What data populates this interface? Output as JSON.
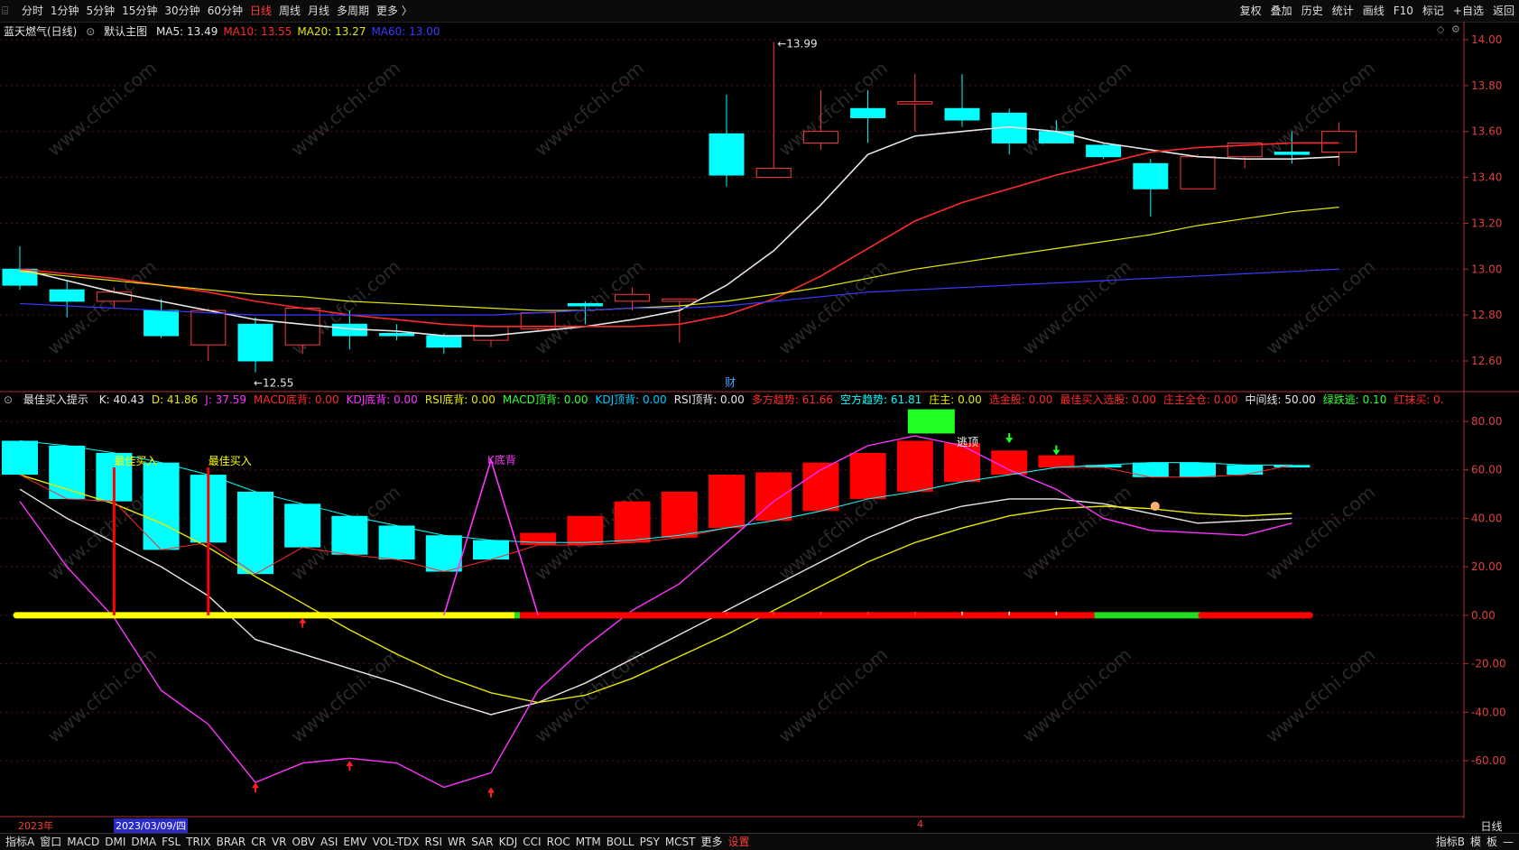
{
  "toolbar": {
    "timeframes": [
      "分时",
      "1分钟",
      "5分钟",
      "15分钟",
      "30分钟",
      "60分钟",
      "日线",
      "周线",
      "月线",
      "多周期",
      "更多 〉"
    ],
    "active_timeframe": "日线",
    "right_buttons": [
      "复权",
      "叠加",
      "历史",
      "统计",
      "画线",
      "F10",
      "标记",
      "+自选",
      "返回"
    ]
  },
  "main_panel": {
    "title": "蓝天燃气(日线)",
    "template": "默认主图",
    "ma": [
      {
        "label": "MA5: 13.49",
        "color": "#e6e6e6"
      },
      {
        "label": "MA10: 13.55",
        "color": "#ff2a2a"
      },
      {
        "label": "MA20: 13.27",
        "color": "#e6e600"
      },
      {
        "label": "MA60: 13.00",
        "color": "#3a3aff"
      }
    ],
    "price_ticks": [
      "14.00",
      "13.80",
      "13.60",
      "13.40",
      "13.20",
      "13.00",
      "12.80",
      "12.60"
    ],
    "high_label": "13.99",
    "low_label": "12.55",
    "fin_marker": "财"
  },
  "indicator_panel": {
    "name": "最佳买入提示",
    "values": [
      {
        "label": "K: 40.43",
        "color": "#e6e6e6"
      },
      {
        "label": "D: 41.86",
        "color": "#e6e600"
      },
      {
        "label": "J: 37.59",
        "color": "#ff33ff"
      },
      {
        "label": "MACD底背: 0.00",
        "color": "#ff2a2a"
      },
      {
        "label": "KDJ底背: 0.00",
        "color": "#ff33ff"
      },
      {
        "label": "RSI底背: 0.00",
        "color": "#e6e600"
      },
      {
        "label": "MACD顶背: 0.00",
        "color": "#33ff33"
      },
      {
        "label": "KDJ顶背: 0.00",
        "color": "#00ccff"
      },
      {
        "label": "RSI顶背: 0.00",
        "color": "#e6e6e6"
      },
      {
        "label": "多方趋势: 61.66",
        "color": "#ff2a2a"
      },
      {
        "label": "空方趋势: 61.81",
        "color": "#00ffff"
      },
      {
        "label": "庄主: 0.00",
        "color": "#e6e600"
      },
      {
        "label": "选金股: 0.00",
        "color": "#ff2a2a"
      },
      {
        "label": "最佳买入选股: 0.00",
        "color": "#ff2a2a"
      },
      {
        "label": "庄主全仓: 0.00",
        "color": "#ff2a2a"
      },
      {
        "label": "中间线: 50.00",
        "color": "#e6e6e6"
      },
      {
        "label": "绿跌逃: 0.10",
        "color": "#33ff33"
      },
      {
        "label": "红抹买: 0.",
        "color": "#ff2a2a"
      }
    ],
    "ticks": [
      "80.00",
      "60.00",
      "40.00",
      "20.00",
      "0.00",
      "-20.00",
      "-40.00",
      "-60.00"
    ],
    "buy_labels": [
      "最佳买入",
      "最佳买入"
    ],
    "kdj_label": "K底背",
    "escape_label": "逃顶"
  },
  "date_axis": {
    "year": "2023年",
    "cursor_date": "2023/03/09/四",
    "month": "4",
    "cycle": "日线"
  },
  "bottom_tabs": [
    "指标A",
    "窗口",
    "MACD",
    "DMI",
    "DMA",
    "FSL",
    "TRIX",
    "BRAR",
    "CR",
    "VR",
    "OBV",
    "ASI",
    "EMV",
    "VOL-TDX",
    "RSI",
    "WR",
    "SAR",
    "KDJ",
    "CCI",
    "ROC",
    "MTM",
    "BOLL",
    "PSY",
    "MCST",
    "更多",
    "设置"
  ],
  "bottom_right": [
    "指标B",
    "模",
    "板",
    "—"
  ],
  "watermark": "www.cfchi.com",
  "chart_data": [
    {
      "type": "candlestick",
      "title": "蓝天燃气(日线)",
      "ylim": [
        12.5,
        14.05
      ],
      "candles": [
        {
          "o": 13.0,
          "h": 13.1,
          "l": 12.91,
          "c": 12.93
        },
        {
          "o": 12.91,
          "h": 12.95,
          "l": 12.79,
          "c": 12.86
        },
        {
          "o": 12.86,
          "h": 12.92,
          "l": 12.83,
          "c": 12.9
        },
        {
          "o": 12.82,
          "h": 12.87,
          "l": 12.7,
          "c": 12.71
        },
        {
          "o": 12.67,
          "h": 12.83,
          "l": 12.6,
          "c": 12.82
        },
        {
          "o": 12.76,
          "h": 12.79,
          "l": 12.55,
          "c": 12.6
        },
        {
          "o": 12.67,
          "h": 12.83,
          "l": 12.63,
          "c": 12.83
        },
        {
          "o": 12.76,
          "h": 12.82,
          "l": 12.65,
          "c": 12.71
        },
        {
          "o": 12.72,
          "h": 12.76,
          "l": 12.69,
          "c": 12.71
        },
        {
          "o": 12.71,
          "h": 12.72,
          "l": 12.63,
          "c": 12.66
        },
        {
          "o": 12.69,
          "h": 12.75,
          "l": 12.66,
          "c": 12.75
        },
        {
          "o": 12.74,
          "h": 12.8,
          "l": 12.73,
          "c": 12.81
        },
        {
          "o": 12.85,
          "h": 12.86,
          "l": 12.76,
          "c": 12.84
        },
        {
          "o": 12.86,
          "h": 12.92,
          "l": 12.82,
          "c": 12.89
        },
        {
          "o": 12.86,
          "h": 12.87,
          "l": 12.68,
          "c": 12.87
        },
        {
          "o": 13.59,
          "h": 13.76,
          "l": 13.36,
          "c": 13.41
        },
        {
          "o": 13.4,
          "h": 13.99,
          "l": 13.4,
          "c": 13.44
        },
        {
          "o": 13.55,
          "h": 13.78,
          "l": 13.52,
          "c": 13.6
        },
        {
          "o": 13.7,
          "h": 13.78,
          "l": 13.55,
          "c": 13.66
        },
        {
          "o": 13.72,
          "h": 13.85,
          "l": 13.6,
          "c": 13.73
        },
        {
          "o": 13.7,
          "h": 13.85,
          "l": 13.62,
          "c": 13.65
        },
        {
          "o": 13.68,
          "h": 13.7,
          "l": 13.5,
          "c": 13.55
        },
        {
          "o": 13.6,
          "h": 13.65,
          "l": 13.55,
          "c": 13.55
        },
        {
          "o": 13.54,
          "h": 13.55,
          "l": 13.48,
          "c": 13.49
        },
        {
          "o": 13.46,
          "h": 13.48,
          "l": 13.23,
          "c": 13.35
        },
        {
          "o": 13.35,
          "h": 13.5,
          "l": 13.35,
          "c": 13.49
        },
        {
          "o": 13.49,
          "h": 13.55,
          "l": 13.44,
          "c": 13.55
        },
        {
          "o": 13.51,
          "h": 13.6,
          "l": 13.46,
          "c": 13.5
        },
        {
          "o": 13.51,
          "h": 13.64,
          "l": 13.45,
          "c": 13.6
        }
      ],
      "series": [
        {
          "name": "MA5",
          "color": "#e6e6e6",
          "values": [
            13.0,
            12.95,
            12.9,
            12.86,
            12.82,
            12.78,
            12.76,
            12.74,
            12.73,
            12.71,
            12.71,
            12.73,
            12.75,
            12.78,
            12.82,
            12.93,
            13.08,
            13.28,
            13.5,
            13.58,
            13.6,
            13.62,
            13.6,
            13.55,
            13.52,
            13.49,
            13.48,
            13.48,
            13.49
          ]
        },
        {
          "name": "MA10",
          "color": "#ff2a2a",
          "values": [
            13.0,
            12.98,
            12.96,
            12.93,
            12.9,
            12.86,
            12.83,
            12.8,
            12.78,
            12.76,
            12.75,
            12.75,
            12.75,
            12.75,
            12.76,
            12.8,
            12.87,
            12.97,
            13.09,
            13.21,
            13.29,
            13.35,
            13.41,
            13.46,
            13.51,
            13.53,
            13.54,
            13.55,
            13.55
          ]
        },
        {
          "name": "MA20",
          "color": "#e6e600",
          "values": [
            12.99,
            12.97,
            12.95,
            12.93,
            12.91,
            12.89,
            12.88,
            12.86,
            12.85,
            12.84,
            12.83,
            12.82,
            12.82,
            12.83,
            12.84,
            12.86,
            12.89,
            12.92,
            12.96,
            13.0,
            13.03,
            13.06,
            13.09,
            13.12,
            13.15,
            13.19,
            13.22,
            13.25,
            13.27
          ]
        },
        {
          "name": "MA60",
          "color": "#3a3aff",
          "values": [
            12.85,
            12.84,
            12.83,
            12.82,
            12.81,
            12.8,
            12.8,
            12.8,
            12.8,
            12.8,
            12.8,
            12.81,
            12.82,
            12.83,
            12.83,
            12.84,
            12.86,
            12.88,
            12.9,
            12.91,
            12.92,
            12.93,
            12.94,
            12.95,
            12.96,
            12.97,
            12.98,
            12.99,
            13.0
          ]
        }
      ]
    },
    {
      "type": "line",
      "title": "最佳买入提示",
      "ylim": [
        -80,
        90
      ],
      "bars": [
        {
          "top": 72,
          "bottom": 58,
          "color": "cyan"
        },
        {
          "top": 70,
          "bottom": 48,
          "color": "cyan"
        },
        {
          "top": 67,
          "bottom": 47,
          "color": "cyan"
        },
        {
          "top": 63,
          "bottom": 27,
          "color": "cyan"
        },
        {
          "top": 58,
          "bottom": 30,
          "color": "cyan"
        },
        {
          "top": 51,
          "bottom": 17,
          "color": "cyan"
        },
        {
          "top": 46,
          "bottom": 28,
          "color": "cyan"
        },
        {
          "top": 41,
          "bottom": 25,
          "color": "cyan"
        },
        {
          "top": 37,
          "bottom": 23,
          "color": "cyan"
        },
        {
          "top": 33,
          "bottom": 18,
          "color": "cyan"
        },
        {
          "top": 31,
          "bottom": 23,
          "color": "cyan"
        },
        {
          "top": 34,
          "bottom": 29,
          "color": "red"
        },
        {
          "top": 41,
          "bottom": 29,
          "color": "red"
        },
        {
          "top": 47,
          "bottom": 30,
          "color": "red"
        },
        {
          "top": 51,
          "bottom": 32,
          "color": "red"
        },
        {
          "top": 58,
          "bottom": 36,
          "color": "red"
        },
        {
          "top": 59,
          "bottom": 39,
          "color": "red"
        },
        {
          "top": 63,
          "bottom": 43,
          "color": "red"
        },
        {
          "top": 67,
          "bottom": 48,
          "color": "red"
        },
        {
          "top": 72,
          "bottom": 51,
          "color": "red"
        },
        {
          "top": 71,
          "bottom": 55,
          "color": "red"
        },
        {
          "top": 68,
          "bottom": 58,
          "color": "red"
        },
        {
          "top": 66,
          "bottom": 61,
          "color": "red"
        },
        {
          "top": 62,
          "bottom": 61,
          "color": "cyan"
        },
        {
          "top": 63,
          "bottom": 57,
          "color": "cyan"
        },
        {
          "top": 63,
          "bottom": 57,
          "color": "cyan"
        },
        {
          "top": 62,
          "bottom": 58,
          "color": "cyan"
        },
        {
          "top": 62,
          "bottom": 61,
          "color": "cyan"
        }
      ],
      "series": [
        {
          "name": "K",
          "color": "#e6e6e6",
          "values": [
            52,
            40,
            30,
            20,
            8,
            -10,
            -16,
            -22,
            -28,
            -35,
            -41,
            -36,
            -28,
            -18,
            -8,
            2,
            12,
            22,
            32,
            40,
            45,
            48,
            48,
            46,
            42,
            38,
            39,
            40
          ]
        },
        {
          "name": "D",
          "color": "#e6e600",
          "values": [
            58,
            52,
            46,
            38,
            28,
            16,
            5,
            -6,
            -16,
            -25,
            -32,
            -36,
            -33,
            -26,
            -17,
            -8,
            2,
            12,
            22,
            30,
            36,
            41,
            44,
            45,
            44,
            42,
            41,
            42
          ]
        },
        {
          "name": "J",
          "color": "#ff33ff",
          "values": [
            47,
            20,
            -1,
            -31,
            -45,
            -69,
            -61,
            -59,
            -61,
            -71,
            -65,
            -31,
            -13,
            2,
            13,
            30,
            47,
            60,
            70,
            74,
            70,
            60,
            52,
            40,
            35,
            34,
            33,
            38
          ]
        },
        {
          "name": "多方趋势",
          "color": "#ff2a2a",
          "values": [
            58,
            48,
            47,
            27,
            30,
            17,
            28,
            25,
            23,
            18,
            23,
            29,
            29,
            30,
            32,
            36,
            39,
            43,
            48,
            51,
            55,
            58,
            61,
            61,
            57,
            57,
            58,
            62
          ]
        },
        {
          "name": "空方趋势",
          "color": "#00ffff",
          "values": [
            72,
            70,
            67,
            63,
            58,
            51,
            46,
            41,
            37,
            33,
            31,
            30,
            30,
            31,
            33,
            36,
            39,
            43,
            48,
            51,
            55,
            58,
            61,
            62,
            63,
            63,
            62,
            62
          ]
        }
      ]
    }
  ]
}
